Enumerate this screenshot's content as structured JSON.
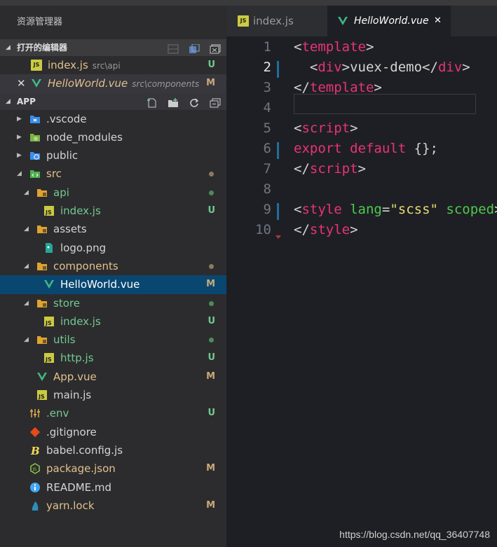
{
  "sidebar": {
    "title": "资源管理器",
    "open_editors": {
      "label": "打开的编辑器",
      "items": [
        {
          "name": "index.js",
          "path": "src\\api",
          "badge": "U",
          "icon": "js-icon"
        },
        {
          "name": "HelloWorld.vue",
          "path": "src\\components",
          "badge": "M",
          "icon": "vue-icon",
          "close": "✕"
        }
      ]
    },
    "workspace": {
      "label": "APP",
      "tree": [
        {
          "name": ".vscode",
          "icon": "vscode-folder-icon",
          "depth": 0,
          "twisty": "▶"
        },
        {
          "name": "node_modules",
          "icon": "node-folder-icon",
          "depth": 0,
          "twisty": "▶"
        },
        {
          "name": "public",
          "icon": "public-folder-icon",
          "depth": 0,
          "twisty": "▶"
        },
        {
          "name": "src",
          "icon": "src-folder-icon",
          "depth": 0,
          "twisty": "◢",
          "dot": "#8a7a62"
        },
        {
          "name": "api",
          "icon": "folder-icon",
          "depth": 1,
          "twisty": "◢",
          "dot": "#4f8a5a"
        },
        {
          "name": "index.js",
          "icon": "js-icon",
          "depth": 2,
          "badge": "U"
        },
        {
          "name": "assets",
          "icon": "folder-icon",
          "depth": 1,
          "twisty": "◢"
        },
        {
          "name": "logo.png",
          "icon": "image-icon",
          "depth": 2
        },
        {
          "name": "components",
          "icon": "folder-icon",
          "depth": 1,
          "twisty": "◢",
          "dot": "#8a7a62"
        },
        {
          "name": "HelloWorld.vue",
          "icon": "vue-icon",
          "depth": 2,
          "badge": "M",
          "selected": true
        },
        {
          "name": "store",
          "icon": "folder-icon",
          "depth": 1,
          "twisty": "◢",
          "dot": "#4f8a5a"
        },
        {
          "name": "index.js",
          "icon": "js-icon",
          "depth": 2,
          "badge": "U"
        },
        {
          "name": "utils",
          "icon": "folder-icon",
          "depth": 1,
          "twisty": "◢",
          "dot": "#4f8a5a"
        },
        {
          "name": "http.js",
          "icon": "js-icon",
          "depth": 2,
          "badge": "U"
        },
        {
          "name": "App.vue",
          "icon": "vue-icon",
          "depth": 1,
          "badge": "M"
        },
        {
          "name": "main.js",
          "icon": "js-icon",
          "depth": 1
        },
        {
          "name": ".env",
          "icon": "settings-icon",
          "depth": 0,
          "badge": "U"
        },
        {
          "name": ".gitignore",
          "icon": "git-icon",
          "depth": 0
        },
        {
          "name": "babel.config.js",
          "icon": "babel-icon",
          "depth": 0
        },
        {
          "name": "package.json",
          "icon": "nodejs-icon",
          "depth": 0,
          "badge": "M"
        },
        {
          "name": "README.md",
          "icon": "info-icon",
          "depth": 0
        },
        {
          "name": "yarn.lock",
          "icon": "yarn-icon",
          "depth": 0,
          "badge": "M"
        }
      ]
    }
  },
  "tabs": [
    {
      "label": "index.js",
      "icon": "js-icon",
      "active": false
    },
    {
      "label": "HelloWorld.vue",
      "icon": "vue-icon",
      "active": true,
      "close": "✕"
    }
  ],
  "editor": {
    "current_line": 2,
    "line_numbers": [
      "1",
      "2",
      "3",
      "4",
      "5",
      "6",
      "7",
      "8",
      "9",
      "10"
    ],
    "lines": [
      [
        [
          "t-br",
          "<"
        ],
        [
          "t-tag",
          "template"
        ],
        [
          "t-br",
          ">"
        ]
      ],
      [
        [
          "t-br",
          "  <"
        ],
        [
          "t-tag",
          "div"
        ],
        [
          "t-br",
          ">vuex-demo</"
        ],
        [
          "t-tag",
          "div"
        ],
        [
          "t-br",
          ">"
        ]
      ],
      [
        [
          "t-br",
          "</"
        ],
        [
          "t-tag",
          "template"
        ],
        [
          "t-br",
          ">"
        ]
      ],
      [],
      [
        [
          "t-br",
          "<"
        ],
        [
          "t-tag",
          "script"
        ],
        [
          "t-br",
          ">"
        ]
      ],
      [
        [
          "t-kw",
          "export"
        ],
        [
          "t-br",
          " "
        ],
        [
          "t-kw",
          "default"
        ],
        [
          "t-br",
          " {};"
        ]
      ],
      [
        [
          "t-br",
          "</"
        ],
        [
          "t-tag",
          "script"
        ],
        [
          "t-br",
          ">"
        ]
      ],
      [],
      [
        [
          "t-br",
          "<"
        ],
        [
          "t-tag",
          "style"
        ],
        [
          "t-br",
          " "
        ],
        [
          "t-attr",
          "lang"
        ],
        [
          "t-br",
          "="
        ],
        [
          "t-str",
          "\"scss\""
        ],
        [
          "t-br",
          " "
        ],
        [
          "t-attr",
          "scoped"
        ],
        [
          "t-br",
          ">"
        ]
      ],
      [
        [
          "t-br",
          "</"
        ],
        [
          "t-tag",
          "style"
        ],
        [
          "t-br",
          ">"
        ]
      ]
    ],
    "changed_lines": [
      2,
      6,
      9
    ]
  },
  "watermark": "https://blog.csdn.net/qq_36407748",
  "colors": {
    "accent_selected": "#094771",
    "untracked": "#73c991",
    "modified": "#e2c08d"
  }
}
